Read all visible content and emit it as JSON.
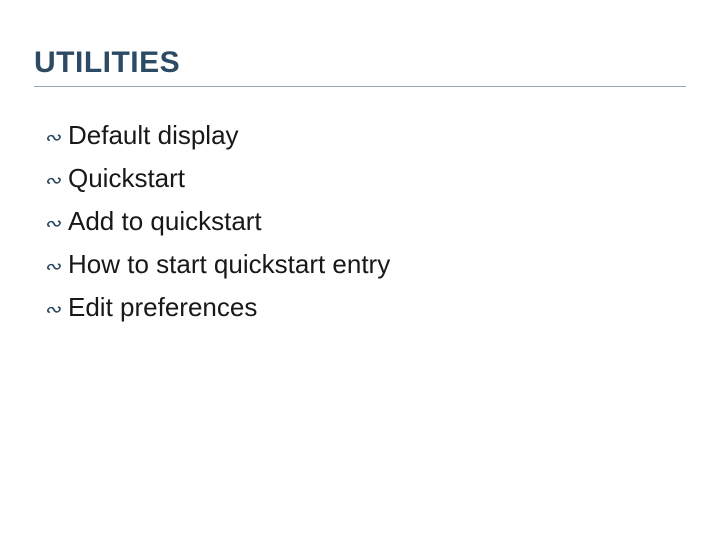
{
  "title": "UTILITIES",
  "bullet_glyph": "ॐ",
  "items": [
    "Default display",
    "Quickstart",
    "Add to quickstart",
    "How to start quickstart entry",
    "Edit preferences"
  ]
}
